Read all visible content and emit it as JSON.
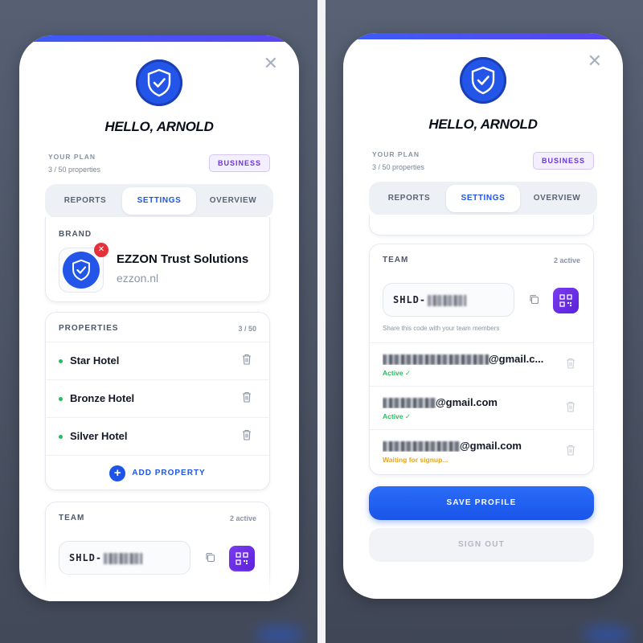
{
  "left": {
    "greeting": "HELLO, ARNOLD",
    "plan_label": "YOUR PLAN",
    "plan_usage": "3 / 50 properties",
    "plan_badge": "BUSINESS",
    "tabs": [
      {
        "label": "REPORTS"
      },
      {
        "label": "SETTINGS"
      },
      {
        "label": "OVERVIEW"
      }
    ],
    "brand": {
      "heading": "BRAND",
      "name": "EZZON Trust Solutions",
      "url": "ezzon.nl"
    },
    "properties": {
      "heading": "PROPERTIES",
      "count": "3 / 50",
      "items": [
        {
          "name": "Star Hotel"
        },
        {
          "name": "Bronze Hotel"
        },
        {
          "name": "Silver Hotel"
        }
      ],
      "add_label": "ADD PROPERTY"
    },
    "team": {
      "heading": "TEAM",
      "count": "2 active",
      "code_prefix": "SHLD-"
    }
  },
  "right": {
    "greeting": "HELLO, ARNOLD",
    "plan_label": "YOUR PLAN",
    "plan_usage": "3 / 50 properties",
    "plan_badge": "BUSINESS",
    "tabs": [
      {
        "label": "REPORTS"
      },
      {
        "label": "SETTINGS"
      },
      {
        "label": "OVERVIEW"
      }
    ],
    "team": {
      "heading": "TEAM",
      "count": "2 active",
      "code_prefix": "SHLD-",
      "share_hint": "Share this code with your team members",
      "members": [
        {
          "email_suffix": "@gmail.c...",
          "status": "Active ✓"
        },
        {
          "email_suffix": "@gmail.com",
          "status": "Active ✓"
        },
        {
          "email_suffix": "@gmail.com",
          "status": "Waiting for signup..."
        }
      ]
    },
    "save_label": "SAVE PROFILE",
    "signout_label": "SIGN OUT"
  },
  "colors": {
    "primary": "#1f55e6",
    "active_status": "#1fbf5b",
    "waiting_status": "#f0a313",
    "badge": "#6a34e0",
    "danger": "#e4313a"
  },
  "icons": [
    "shield-check-icon",
    "close-icon",
    "remove-icon",
    "trash-icon",
    "plus-icon",
    "copy-icon",
    "qr-code-icon"
  ]
}
